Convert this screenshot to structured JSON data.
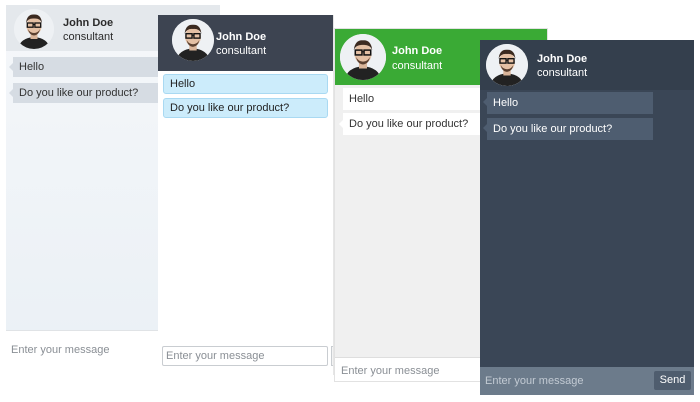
{
  "chat_widgets": [
    {
      "theme": "light-gray",
      "header": {
        "name": "John Doe",
        "role": "consultant"
      },
      "messages": [
        "Hello",
        "Do you like our product?"
      ],
      "input": {
        "placeholder": "Enter your message"
      }
    },
    {
      "theme": "dark-header-white-body",
      "header": {
        "name": "John Doe",
        "role": "consultant"
      },
      "messages": [
        "Hello",
        "Do you like our product?"
      ],
      "input": {
        "placeholder": "Enter your message"
      }
    },
    {
      "theme": "green",
      "header": {
        "name": "John Doe",
        "role": "consultant"
      },
      "messages": [
        "Hello",
        "Do you like our product?"
      ],
      "input": {
        "placeholder": "Enter your message"
      }
    },
    {
      "theme": "dark",
      "header": {
        "name": "John Doe",
        "role": "consultant"
      },
      "messages": [
        "Hello",
        "Do you like our product?"
      ],
      "input": {
        "placeholder": "Enter your message",
        "send_label": "Send"
      }
    }
  ],
  "colors": {
    "green_header": "#3aaa35",
    "dark_header": "#3d4451",
    "dark_body": "#3a4656",
    "light_blue_bubble": "#ccecfb"
  },
  "icons": {
    "avatar": "consultant-avatar-icon"
  }
}
